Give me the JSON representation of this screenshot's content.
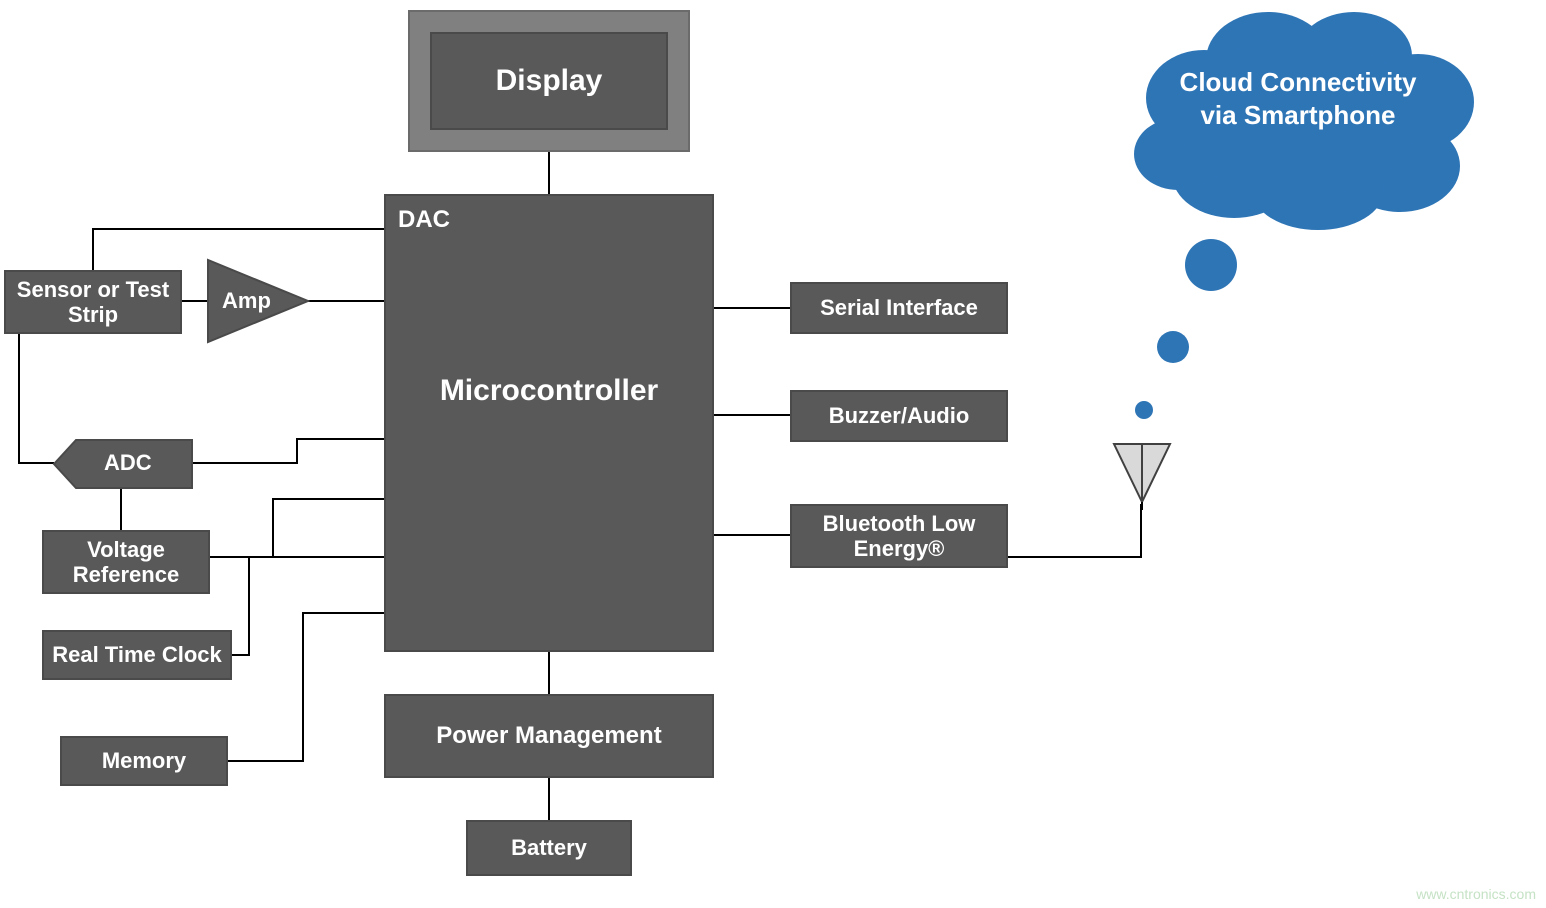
{
  "blocks": {
    "display": "Display",
    "mcu_dac": "DAC",
    "mcu_main": "Microcontroller",
    "sensor": "Sensor or Test Strip",
    "amp": "Amp",
    "adc": "ADC",
    "vref": "Voltage Reference",
    "rtc": "Real Time Clock",
    "memory": "Memory",
    "power": "Power Management",
    "battery": "Battery",
    "serial": "Serial Interface",
    "buzzer": "Buzzer/Audio",
    "ble": "Bluetooth Low Energy®"
  },
  "cloud": {
    "text": "Cloud Connectivity via Smartphone"
  },
  "footer": {
    "watermark": "www.cntronics.com"
  },
  "colors": {
    "block": "#595959",
    "display_frame": "#808080",
    "cloud": "#2E75B6",
    "antenna_fill": "#D9D9D9",
    "antenna_stroke": "#404040"
  }
}
